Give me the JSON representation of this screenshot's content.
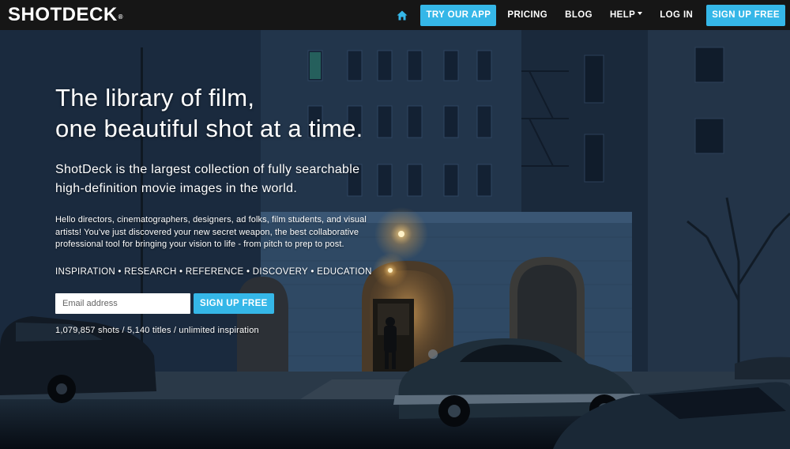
{
  "header": {
    "logo_text": "SHOTDECK",
    "logo_mark": "®",
    "nav": {
      "home_icon": "home-icon",
      "try_app": "TRY OUR APP",
      "pricing": "PRICING",
      "blog": "BLOG",
      "help": "HELP",
      "login": "LOG IN",
      "signup": "SIGN UP FREE"
    }
  },
  "hero": {
    "headline_line1": "The library of film,",
    "headline_line2": "one beautiful shot at a time.",
    "subhead_line1": "ShotDeck is the largest collection of fully searchable",
    "subhead_line2": "high-definition movie images in the world.",
    "intro": "Hello directors, cinematographers, designers, ad folks, film students, and visual artists! You've just discovered your new secret weapon, the best collaborative professional tool for bringing your vision to life - from pitch to prep to post.",
    "tags": "INSPIRATION • RESEARCH • REFERENCE • DISCOVERY • EDUCATION",
    "email_placeholder": "Email address",
    "signup_button": "SIGN UP FREE",
    "stats": "1,079,857 shots / 5,140 titles / unlimited inspiration"
  },
  "colors": {
    "accent": "#35b7e8",
    "topbar": "#161616",
    "scene_dark": "#0b1320"
  }
}
